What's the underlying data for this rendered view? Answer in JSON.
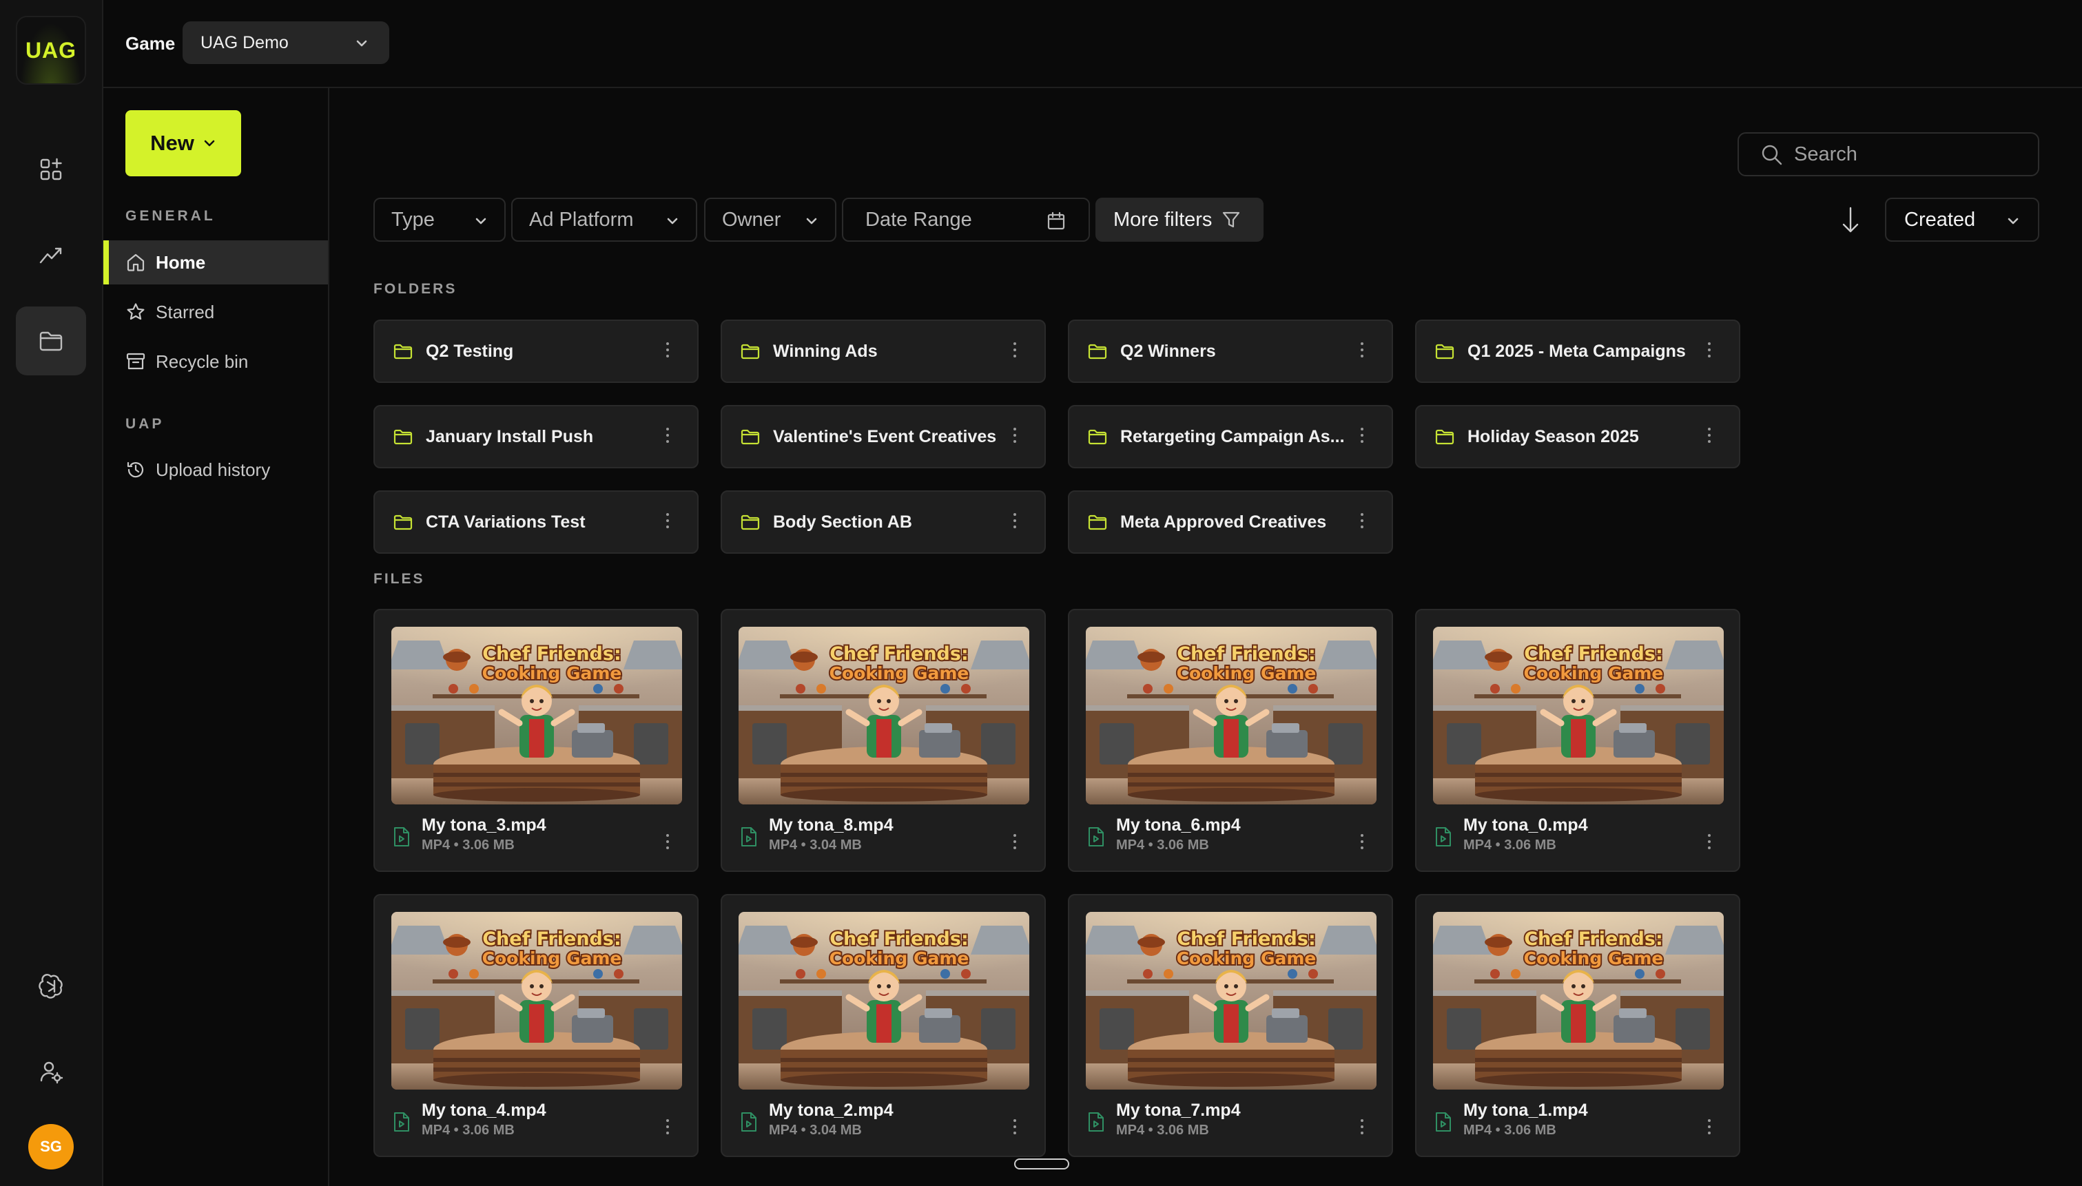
{
  "app": {
    "logo_text": "UAG"
  },
  "rail": {
    "avatar_initials": "SG"
  },
  "topbar": {
    "game_label": "Game",
    "game_value": "UAG Demo"
  },
  "sidebar": {
    "new_label": "New",
    "general_label": "GENERAL",
    "items": [
      {
        "label": "Home",
        "icon": "home-icon"
      },
      {
        "label": "Starred",
        "icon": "star-icon"
      },
      {
        "label": "Recycle bin",
        "icon": "archive-icon"
      }
    ],
    "uap_label": "UAP",
    "uap_items": [
      {
        "label": "Upload history",
        "icon": "history-icon"
      }
    ]
  },
  "main": {
    "search_placeholder": "Search",
    "filters": {
      "type": "Type",
      "ad_platform": "Ad Platform",
      "owner": "Owner",
      "date_range": "Date Range",
      "more": "More filters"
    },
    "sort_value": "Created",
    "folders_heading": "FOLDERS",
    "files_heading": "FILES",
    "folders": [
      "Q2 Testing",
      "Winning Ads",
      "Q2 Winners",
      "Q1 2025 - Meta Campaigns",
      "January Install Push",
      "Valentine's Event Creatives",
      "Retargeting Campaign As...",
      "Holiday Season 2025",
      "CTA Variations Test",
      "Body Section AB",
      "Meta Approved Creatives"
    ],
    "files": [
      {
        "name": "My tona_3.mp4",
        "meta": "MP4 • 3.06 MB"
      },
      {
        "name": "My tona_8.mp4",
        "meta": "MP4 • 3.04 MB"
      },
      {
        "name": "My tona_6.mp4",
        "meta": "MP4 • 3.06 MB"
      },
      {
        "name": "My tona_0.mp4",
        "meta": "MP4 • 3.06 MB"
      },
      {
        "name": "My tona_4.mp4",
        "meta": "MP4 • 3.06 MB"
      },
      {
        "name": "My tona_2.mp4",
        "meta": "MP4 • 3.04 MB"
      },
      {
        "name": "My tona_7.mp4",
        "meta": "MP4 • 3.06 MB"
      },
      {
        "name": "My tona_1.mp4",
        "meta": "MP4 • 3.06 MB"
      }
    ],
    "thumbnail_title_line1": "Chef Friends:",
    "thumbnail_title_line2": "Cooking Game"
  },
  "colors": {
    "accent": "#d4f22a",
    "folder_icon": "#c6e234",
    "file_icon": "#2f8f63",
    "avatar": "#f59a0b"
  }
}
